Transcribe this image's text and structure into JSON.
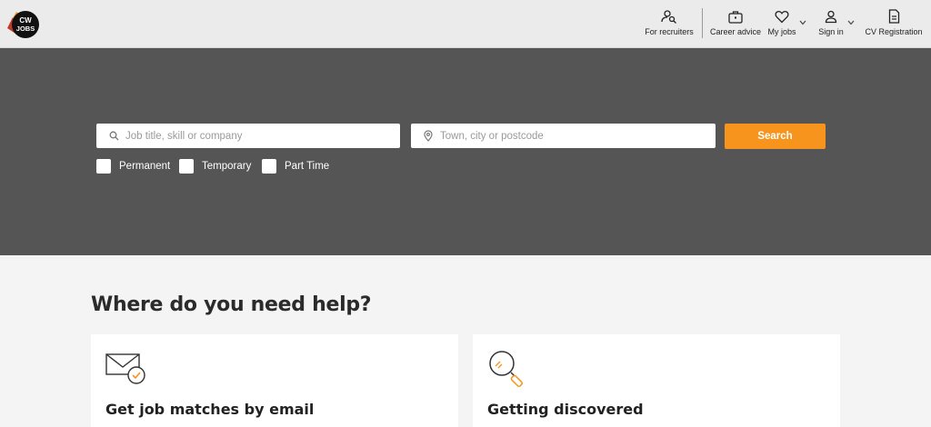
{
  "header": {
    "logo_text": "CW JOBS",
    "nav": {
      "recruiters": "For recruiters",
      "career_advice": "Career advice",
      "my_jobs": "My jobs",
      "sign_in": "Sign in",
      "cv_registration": "CV Registration"
    }
  },
  "hero": {
    "keyword_placeholder": "Job title, skill or company",
    "location_placeholder": "Town, city or postcode",
    "search_label": "Search",
    "job_types": [
      "Permanent",
      "Temporary",
      "Part Time"
    ]
  },
  "help": {
    "title": "Where do you need help?",
    "cards": [
      {
        "title": "Get job matches by email",
        "icon": "envelope-check-icon"
      },
      {
        "title": "Getting discovered",
        "icon": "magnifier-icon"
      }
    ]
  },
  "colors": {
    "accent": "#f7941d",
    "hero_bg": "#555555",
    "header_bg": "#ebebeb"
  }
}
